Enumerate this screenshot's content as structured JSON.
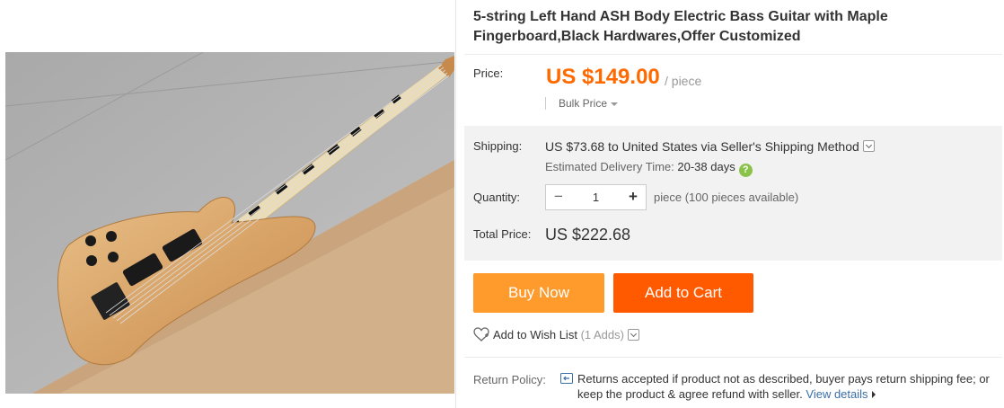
{
  "product": {
    "title": "5-string Left Hand ASH Body Electric Bass Guitar with Maple Fingerboard,Black Hardwares,Offer Customized"
  },
  "price": {
    "label": "Price:",
    "value": "US $149.00",
    "unit": "/ piece",
    "bulk_label": "Bulk Price"
  },
  "shipping": {
    "label": "Shipping:",
    "text": "US $73.68 to United States via Seller's Shipping Method",
    "delivery_label": "Estimated Delivery Time:",
    "delivery_days": "20-38 days"
  },
  "quantity": {
    "label": "Quantity:",
    "value": "1",
    "minus": "−",
    "plus": "+",
    "availability": "piece (100 pieces available)"
  },
  "total": {
    "label": "Total Price:",
    "value": "US $222.68"
  },
  "actions": {
    "buy_now": "Buy Now",
    "add_to_cart": "Add to Cart",
    "wishlist_label": "Add to Wish List",
    "wishlist_count": "(1 Adds)"
  },
  "return_policy": {
    "label": "Return Policy:",
    "text": "Returns accepted if product not as described, buyer pays return shipping fee; or keep the product & agree refund with seller.",
    "link": "View details"
  },
  "colors": {
    "price": "#ff6a00",
    "buy_now": "#ff9a2d",
    "add_to_cart": "#ff5a00",
    "help_icon": "#8bc34a",
    "link": "#3a6ea5"
  }
}
